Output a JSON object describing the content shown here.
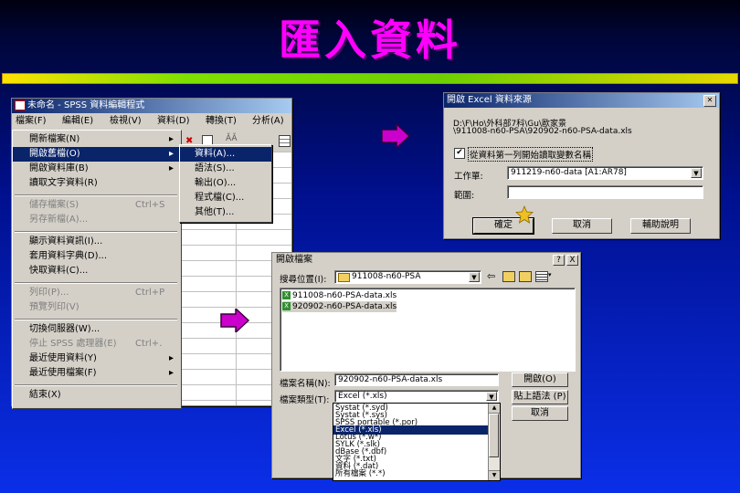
{
  "slide": {
    "title": "匯入資料",
    "colors": {
      "title": "#ff00ff",
      "titlebar": "#0a246a",
      "menu_highlight": "#0a246a"
    }
  },
  "spss": {
    "title": "未命名 - SPSS 資料編輯程式",
    "menubar": [
      "檔案(F)",
      "編輯(E)",
      "檢視(V)",
      "資料(D)",
      "轉換(T)",
      "分析(A)"
    ],
    "file_menu": [
      {
        "label": "開新檔案(N)",
        "arrow": "▸"
      },
      {
        "label": "開啟舊檔(O)",
        "arrow": "▸"
      },
      {
        "label": "開啟資料庫(B)",
        "arrow": "▸"
      },
      {
        "label": "讀取文字資料(R)"
      },
      {
        "label": "儲存檔案(S)",
        "shortcut": "Ctrl+S"
      },
      {
        "label": "另存新檔(A)..."
      },
      {
        "label": "顯示資料資訊(I)..."
      },
      {
        "label": "套用資料字典(D)..."
      },
      {
        "label": "快取資料(C)..."
      },
      {
        "label": "列印(P)...",
        "shortcut": "Ctrl+P"
      },
      {
        "label": "預覽列印(V)"
      },
      {
        "label": "切換伺服器(W)..."
      },
      {
        "label": "停止 SPSS 處理器(E)",
        "shortcut": "Ctrl+."
      },
      {
        "label": "最近使用資料(Y)",
        "arrow": "▸"
      },
      {
        "label": "最近使用檔案(F)",
        "arrow": "▸"
      },
      {
        "label": "結束(X)"
      }
    ],
    "submenu": [
      "資料(A)...",
      "語法(S)...",
      "輸出(O)...",
      "程式檔(C)...",
      "其他(T)..."
    ]
  },
  "excel_dialog": {
    "title": "開啟 Excel 資料來源",
    "path_line1": "D:\\F\\Ho\\外科部7科\\Gu\\歐家景",
    "path_line2": "\\911008-n60-PSA\\920902-n60-PSA-data.xls",
    "checkbox_label": "從資料第一列開始讀取變數名稱",
    "sheet_label": "工作單:",
    "sheet_value": "911219-n60-data  [A1:AR78]",
    "range_label": "範圍:",
    "range_value": "",
    "ok": "確定",
    "cancel": "取消",
    "help": "輔助說明"
  },
  "open_dialog": {
    "title": "開啟檔案",
    "title_buttons": [
      "?",
      "X"
    ],
    "lookin_label": "搜尋位置(I):",
    "lookin_value": "911008-n60-PSA",
    "files": [
      "911008-n60-PSA-data.xls",
      "920902-n60-PSA-data.xls"
    ],
    "filename_label": "檔案名稱(N):",
    "filename_value": "920902-n60-PSA-data.xls",
    "filetype_label": "檔案類型(T):",
    "filetype_value": "Excel (*.xls)",
    "open_button": "開啟(O)",
    "paste_button": "貼上語法 (P)",
    "cancel_button": "取消",
    "type_options": [
      "Systat (*.syd)",
      "Systat (*.sys)",
      "SPSS portable (*.por)",
      "Excel (*.xls)",
      "Lotus (*.w*)",
      "SYLK (*.slk)",
      "dBase (*.dbf)",
      "文字 (*.txt)",
      "資料 (*.dat)",
      "所有檔案 (*.*)"
    ],
    "selected_option": "Excel (*.xls)"
  }
}
